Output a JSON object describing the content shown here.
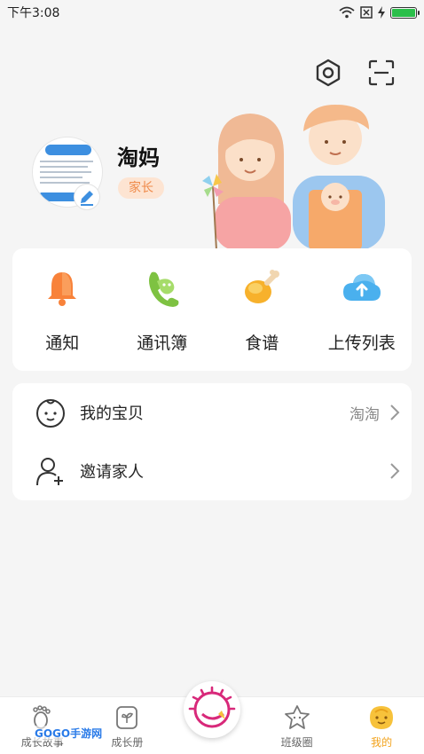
{
  "status_bar": {
    "time": "下午3:08"
  },
  "profile": {
    "name": "淘妈",
    "role": "家长"
  },
  "quick_actions": [
    {
      "label": "通知",
      "icon": "bell-icon"
    },
    {
      "label": "通讯簿",
      "icon": "contacts-icon"
    },
    {
      "label": "食谱",
      "icon": "drumstick-icon"
    },
    {
      "label": "上传列表",
      "icon": "cloud-upload-icon"
    }
  ],
  "list": {
    "baby": {
      "label": "我的宝贝",
      "value": "淘淘"
    },
    "invite": {
      "label": "邀请家人"
    }
  },
  "tabs": [
    {
      "label": "成长故事",
      "icon": "footprint-icon"
    },
    {
      "label": "成长册",
      "icon": "album-icon"
    },
    {
      "label": "班级圈",
      "icon": "star-icon"
    },
    {
      "label": "我的",
      "icon": "face-icon"
    }
  ],
  "watermark": "GOGO手游网",
  "colors": {
    "accent": "#f2a21b",
    "badge_bg": "#fde4d2",
    "badge_text": "#ef8a4a"
  }
}
